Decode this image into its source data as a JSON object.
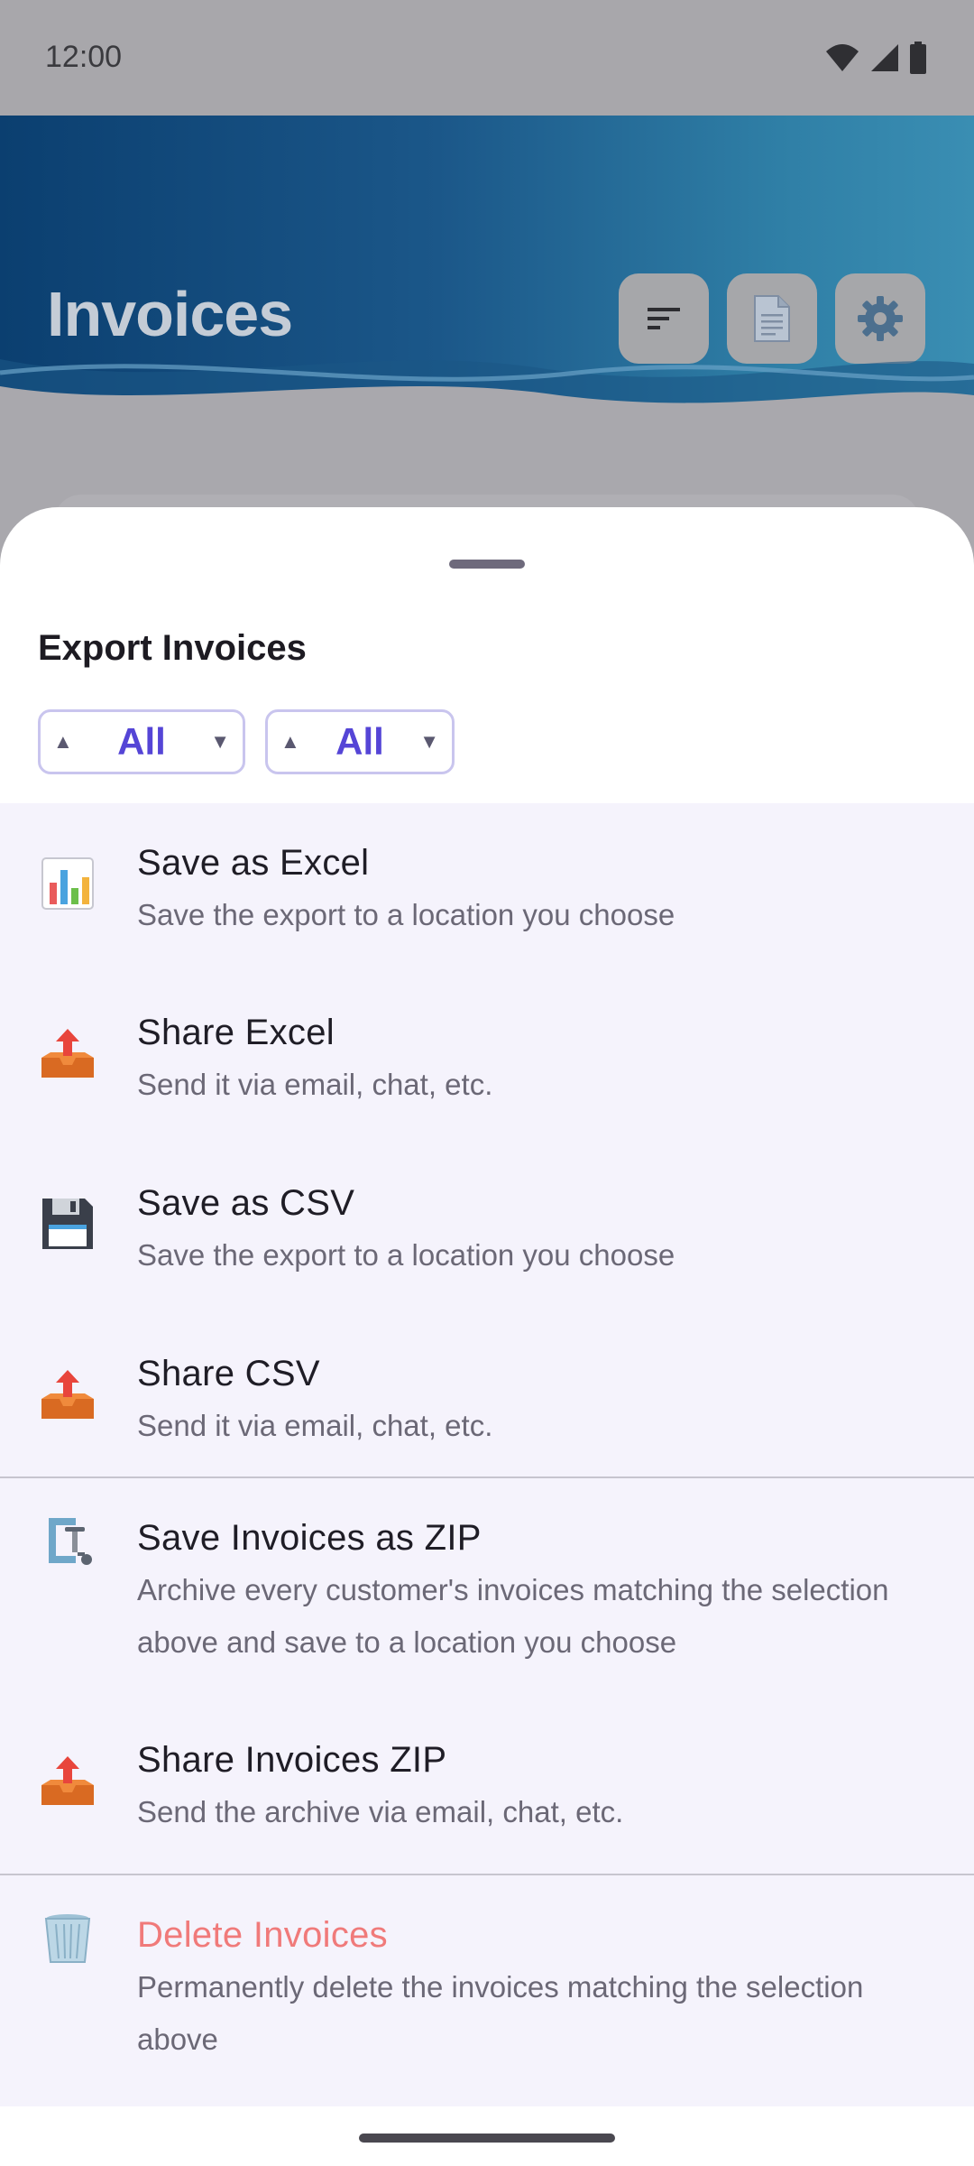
{
  "status_bar": {
    "time": "12:00",
    "icons": [
      "wifi-icon",
      "signal-icon",
      "battery-icon"
    ]
  },
  "header": {
    "title": "Invoices",
    "buttons": [
      "sort-icon",
      "document-icon",
      "gear-icon"
    ]
  },
  "sheet": {
    "title": "Export Invoices",
    "filters": [
      {
        "value": "All"
      },
      {
        "value": "All"
      }
    ],
    "items": [
      {
        "icon": "bar-chart-icon",
        "title": "Save as Excel",
        "subtitle": "Save the export to a location you choose"
      },
      {
        "icon": "outbox-tray-icon",
        "title": "Share Excel",
        "subtitle": "Send it via email, chat, etc."
      },
      {
        "icon": "floppy-disk-icon",
        "title": "Save as CSV",
        "subtitle": "Save the export to a location you choose"
      },
      {
        "icon": "outbox-tray-icon",
        "title": "Share CSV",
        "subtitle": "Send it via email, chat, etc."
      },
      {
        "icon": "clamp-icon",
        "title": "Save Invoices as ZIP",
        "subtitle": "Archive every customer's invoices matching the selection above and save to a location you choose"
      },
      {
        "icon": "outbox-tray-icon",
        "title": "Share Invoices ZIP",
        "subtitle": "Send the archive via email, chat, etc."
      },
      {
        "icon": "wastebasket-icon",
        "title": "Delete Invoices",
        "subtitle": "Permanently delete the invoices matching the selection above"
      }
    ]
  },
  "colors": {
    "accent": "#5545d6",
    "danger": "#f07a7a",
    "list_bg": "#f5f3fc"
  }
}
